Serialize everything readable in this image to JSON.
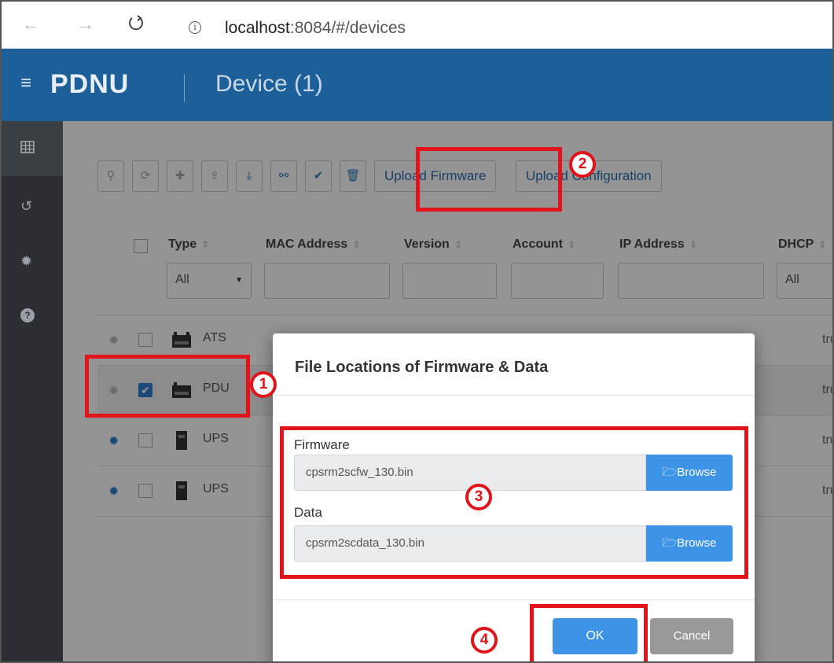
{
  "browser": {
    "url_host": "localhost",
    "url_rest": ":8084/#/devices",
    "back_glyph": "←",
    "forward_glyph": "→"
  },
  "app": {
    "brand": "PDNU",
    "page_title": "Device (1)",
    "accent": "#1d5f98"
  },
  "toolbar": {
    "icons": [
      "search-icon",
      "refresh-icon",
      "add-icon",
      "upload-icon",
      "download-icon",
      "link-icon",
      "check-icon",
      "delete-icon"
    ],
    "upload_firmware": "Upload Firmware",
    "upload_configuration": "Upload Configuration"
  },
  "table": {
    "headers": {
      "type": "Type",
      "mac": "MAC Address",
      "version": "Version",
      "account": "Account",
      "ip": "IP Address",
      "dhcp": "DHCP"
    },
    "filters": {
      "type": "All",
      "dhcp": "All"
    },
    "rows": [
      {
        "type": "ATS",
        "dhcp": "true",
        "selected": false
      },
      {
        "type": "PDU",
        "dhcp": "true",
        "selected": true
      },
      {
        "type": "UPS",
        "dhcp": "true",
        "selected": false
      },
      {
        "type": "UPS",
        "dhcp": "true",
        "selected": false
      }
    ]
  },
  "modal": {
    "title": "File Locations of Firmware & Data",
    "firmware_label": "Firmware",
    "firmware_value": "cpsrm2scfw_130.bin",
    "data_label": "Data",
    "data_value": "cpsrm2scdata_130.bin",
    "browse_label": "Browse",
    "ok_label": "OK",
    "cancel_label": "Cancel"
  },
  "annotations": {
    "step1": "1",
    "step2": "2",
    "step3": "3",
    "step4": "4",
    "color": "#e0141a"
  }
}
